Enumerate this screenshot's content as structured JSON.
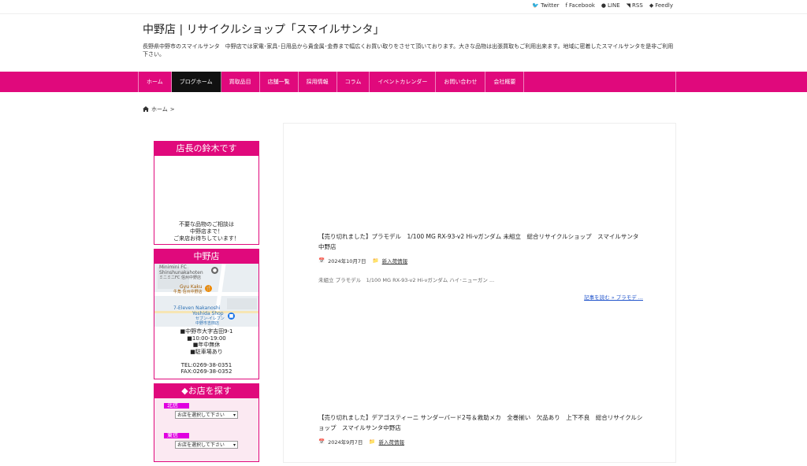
{
  "social": [
    {
      "icon": "twitter-icon",
      "glyph": "🐦",
      "label": "Twitter"
    },
    {
      "icon": "facebook-icon",
      "glyph": "f",
      "label": "Facebook"
    },
    {
      "icon": "line-icon",
      "glyph": "●",
      "label": "LINE"
    },
    {
      "icon": "rss-icon",
      "glyph": "◥",
      "label": "RSS"
    },
    {
      "icon": "feedly-icon",
      "glyph": "◆",
      "label": "Feedly"
    }
  ],
  "header": {
    "title": "中野店 | リサイクルショップ「スマイルサンタ」",
    "description": "長野県中野市のスマイルサンタ　中野店では家電･家具･日用品から貴金属･金券まで幅広くお買い取りをさせて頂いております。大きな品物は出張買取もご利用出来ます。地域に密着したスマイルサンタを是非ご利用下さい。"
  },
  "nav": {
    "items": [
      "ホーム",
      "ブログホーム",
      "買取品目",
      "店舗一覧",
      "採用情報",
      "コラム",
      "イベントカレンダー",
      "お問い合わせ",
      "会社概要"
    ],
    "active_index": 1
  },
  "breadcrumb": {
    "home": "ホーム",
    "sep": ">"
  },
  "sidebar": {
    "manager": {
      "title": "店長の鈴木です",
      "lines": [
        "不要な品物のご相談は",
        "中野店まで！",
        "ご来店お待ちしています！"
      ]
    },
    "store": {
      "title": "中野店",
      "map_labels": [
        "Minimini FC",
        "Shinshunakahoten",
        "ミニミニFC 信州中野店",
        "Gyu Kaku",
        "牛角 信州中野店",
        "7-Eleven Nakanoshi",
        "Yoshida Shop",
        "セブン-イレブン",
        "中野市吉田店"
      ],
      "info": [
        "■中野市大字吉田9-1",
        "■10:00-19:00",
        "■年中無休",
        "■駐車場あり",
        "",
        "TEL:0269-38-0351",
        "FAX:0269-38-0352"
      ]
    },
    "finder": {
      "title": "◆お店を探す",
      "areas": [
        {
          "label": "北信",
          "select": "お店を選択して下さい"
        },
        {
          "label": "東信",
          "select": "お店を選択して下さい"
        }
      ]
    }
  },
  "posts": [
    {
      "title": "【売り切れました】プラモデル　1/100 MG RX-93-v2 Hi-νガンダム 未組立　総合リサイクルショップ　スマイルサンタ中野店",
      "date": "2024年10月7日",
      "category": "新入荷情報",
      "excerpt": "未組立 プラモデル　1/100 MG RX-93-v2 Hi-νガンダム ハイ･ニューガン ...",
      "more": "記事を読む »  プラモデ ..."
    },
    {
      "title": "【売り切れました】デアゴスティーニ サンダーバード2号＆救助メカ　全巻揃い　欠品あり　上下不良　総合リサイクルショップ　スマイルサンタ中野店",
      "date": "2024年9月7日",
      "category": "新入荷情報"
    }
  ],
  "colors": {
    "brand": "#e0097c",
    "nav_active": "#111111",
    "link": "#2255cc"
  }
}
